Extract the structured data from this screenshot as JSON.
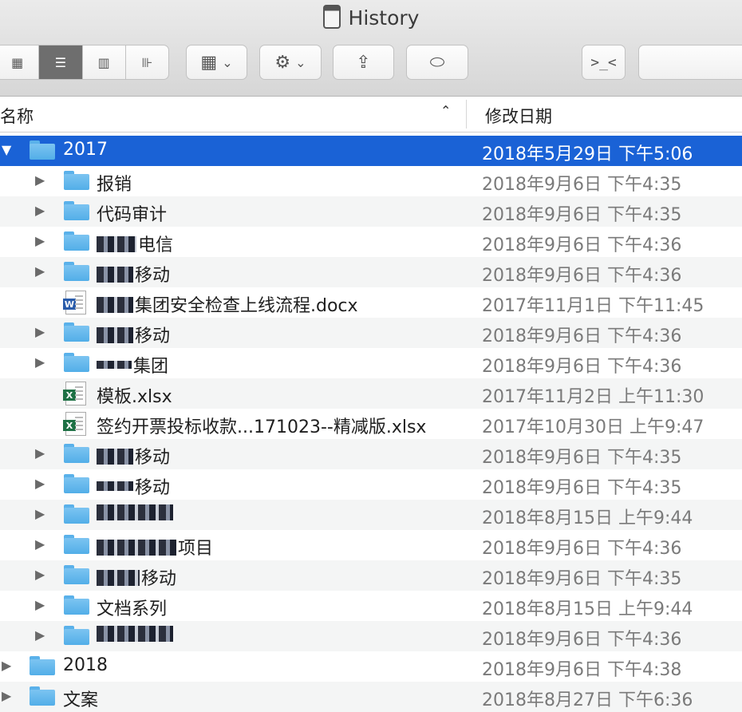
{
  "window": {
    "title": "History"
  },
  "toolbar": {
    "view_icon": "▦",
    "list_icon": "☰",
    "column_icon": "▥",
    "coverflow_icon": "⊪",
    "arrange_icon": "▦",
    "action_icon": "⚙",
    "share_icon": "⇪",
    "tag_icon": "⬭",
    "terminal_label": ">_<",
    "chevron": "⌄"
  },
  "header": {
    "name_col": "名称",
    "date_col": "修改日期",
    "sort_indicator": "⌃"
  },
  "rows": [
    {
      "name": "2017",
      "date": "2018年5月29日 下午5:06"
    },
    {
      "name": "报销",
      "date": "2018年9月6日 下午4:35"
    },
    {
      "name": "代码审计",
      "date": "2018年9月6日 下午4:35"
    },
    {
      "name": "电信",
      "date": "2018年9月6日 下午4:36"
    },
    {
      "name": "移动",
      "date": "2018年9月6日 下午4:36"
    },
    {
      "name": "集团安全检查上线流程.docx",
      "date": "2017年11月1日 下午11:45"
    },
    {
      "name": "移动",
      "date": "2018年9月6日 下午4:36"
    },
    {
      "name": "集团",
      "date": "2018年9月6日 下午4:36"
    },
    {
      "name": "模板.xlsx",
      "date": "2017年11月2日 上午11:30"
    },
    {
      "name": "签约开票投标收款...171023--精减版.xlsx",
      "date": "2017年10月30日 上午9:47"
    },
    {
      "name": "移动",
      "date": "2018年9月6日 下午4:35"
    },
    {
      "name": "移动",
      "date": "2018年9月6日 下午4:35"
    },
    {
      "name": "",
      "date": "2018年8月15日 上午9:44"
    },
    {
      "name": "项目",
      "date": "2018年9月6日 下午4:36"
    },
    {
      "name": "移动",
      "date": "2018年9月6日 下午4:35"
    },
    {
      "name": "文档系列",
      "date": "2018年8月15日 上午9:44"
    },
    {
      "name": "",
      "date": "2018年9月6日 下午4:36"
    },
    {
      "name": "2018",
      "date": "2018年9月6日 下午4:38"
    },
    {
      "name": "文案",
      "date": "2018年8月27日 下午6:36"
    }
  ],
  "triangles": {
    "expanded": "▼",
    "collapsed": "▶"
  },
  "file_badges": {
    "word": "W",
    "excel": "X"
  },
  "colors": {
    "selection": "#1a62d6",
    "folder": "#5ab1ea"
  }
}
